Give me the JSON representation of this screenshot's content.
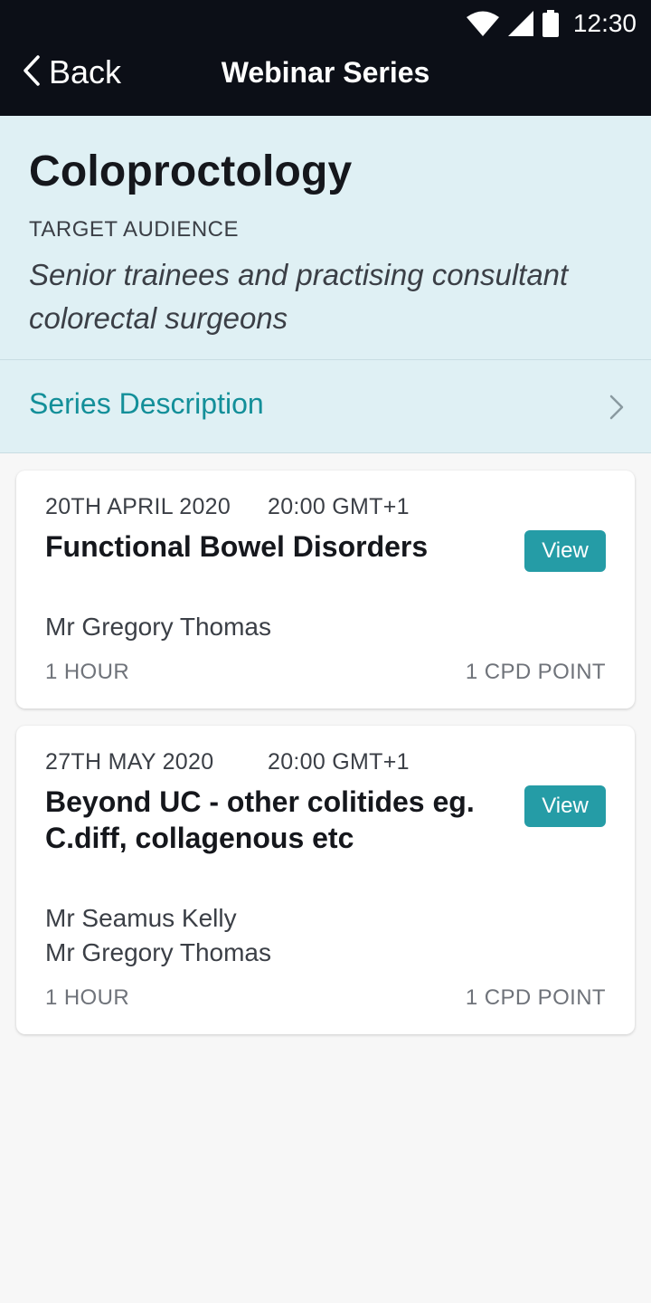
{
  "status_bar": {
    "time": "12:30"
  },
  "nav": {
    "back_label": "Back",
    "title": "Webinar Series"
  },
  "series": {
    "title": "Coloproctology",
    "audience_label": "TARGET AUDIENCE",
    "audience_text": "Senior trainees and practising consultant colorectal surgeons",
    "description_label": "Series Description"
  },
  "webinars": [
    {
      "date": "20TH APRIL 2020",
      "time": "20:00 GMT+1",
      "title": "Functional Bowel Disorders",
      "speakers": [
        "Mr Gregory Thomas"
      ],
      "duration": "1 HOUR",
      "cpd": "1 CPD POINT",
      "button_label": "View"
    },
    {
      "date": "27TH MAY 2020",
      "time": "20:00 GMT+1",
      "title": "Beyond UC - other colitides eg. C.diff, collagenous etc",
      "speakers": [
        "Mr Seamus Kelly",
        "Mr Gregory Thomas"
      ],
      "duration": "1 HOUR",
      "cpd": "1 CPD POINT",
      "button_label": "View"
    }
  ],
  "colors": {
    "topbar": "#0c0f17",
    "header_bg": "#dff0f4",
    "accent": "#259ca6",
    "link": "#138f99"
  }
}
